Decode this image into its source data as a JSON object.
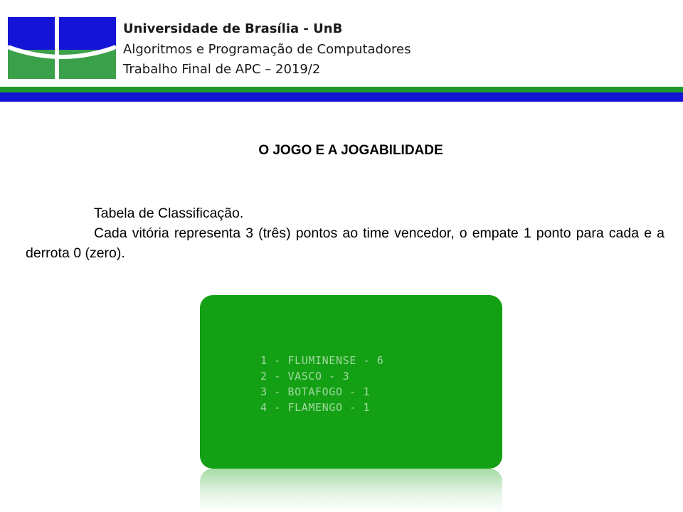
{
  "header": {
    "university": "Universidade de Brasília - UnB",
    "course": "Algoritmos e Programação de Computadores",
    "assignment": "Trabalho Final de APC – 2019/2",
    "logo_icon": "unb-logo-icon"
  },
  "colors": {
    "stripe_green": "#1f9a2a",
    "stripe_blue": "#1414d6",
    "logo_blue": "#1414d6",
    "logo_green": "#3ba04a",
    "terminal_bg": "#14a014",
    "terminal_text": "#9fd99f"
  },
  "main": {
    "section_title": "O JOGO E A JOGABILIDADE",
    "paragraphs": [
      "Tabela de Classificação.",
      "Cada vitória representa 3 (três) pontos ao time vencedor, o empate 1 ponto para cada e a derrota 0 (zero)."
    ]
  },
  "terminal": {
    "lines": [
      "1 - FLUMINENSE - 6",
      "2 - VASCO - 3",
      "3 - BOTAFOGO - 1",
      "4 - FLAMENGO - 1"
    ]
  }
}
